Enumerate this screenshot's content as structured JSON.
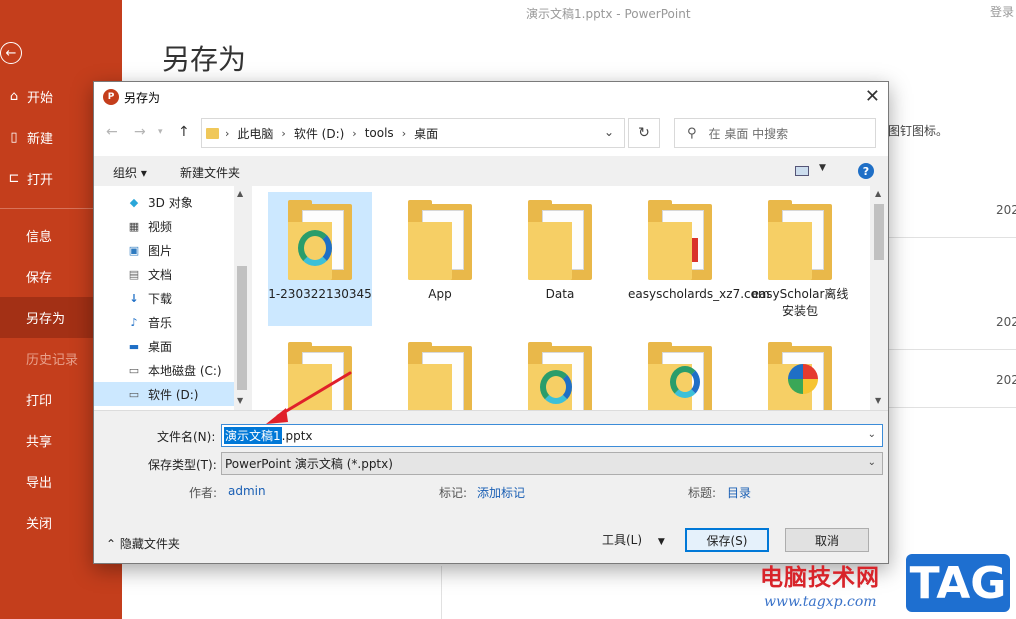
{
  "window_title": "演示文稿1.pptx  -  PowerPoint",
  "login_label": "登录",
  "backstage": {
    "heading": "另存为",
    "hint": "图钉图标。",
    "years": [
      "202",
      "202",
      "202"
    ],
    "menu": [
      {
        "label": "开始",
        "icon": "home-icon",
        "state": "normal"
      },
      {
        "label": "新建",
        "icon": "new-doc-icon",
        "state": "normal"
      },
      {
        "label": "打开",
        "icon": "open-folder-icon",
        "state": "normal"
      },
      {
        "label": "信息",
        "state": "normal"
      },
      {
        "label": "保存",
        "state": "normal"
      },
      {
        "label": "另存为",
        "state": "active"
      },
      {
        "label": "历史记录",
        "state": "disabled"
      },
      {
        "label": "打印",
        "state": "normal"
      },
      {
        "label": "共享",
        "state": "normal"
      },
      {
        "label": "导出",
        "state": "normal"
      },
      {
        "label": "关闭",
        "state": "normal"
      }
    ]
  },
  "dialog": {
    "title": "另存为",
    "address": [
      "此电脑",
      "软件 (D:)",
      "tools",
      "桌面"
    ],
    "search_placeholder": "在 桌面 中搜索",
    "toolbar": {
      "organize": "组织 ▾",
      "new_folder": "新建文件夹"
    },
    "nav_items": [
      {
        "label": "3D 对象",
        "icon": "3d-objects-icon"
      },
      {
        "label": "视频",
        "icon": "video-icon"
      },
      {
        "label": "图片",
        "icon": "pictures-icon"
      },
      {
        "label": "文档",
        "icon": "documents-icon"
      },
      {
        "label": "下载",
        "icon": "download-icon"
      },
      {
        "label": "音乐",
        "icon": "music-icon"
      },
      {
        "label": "桌面",
        "icon": "desktop-icon"
      },
      {
        "label": "本地磁盘 (C:)",
        "icon": "local-disk-icon"
      },
      {
        "label": "软件 (D:)",
        "icon": "drive-icon",
        "selected": true
      }
    ],
    "files": [
      {
        "label": "1-230322130345",
        "selected": true
      },
      {
        "label": "App"
      },
      {
        "label": "Data"
      },
      {
        "label": "easyscholards_xz7.com"
      },
      {
        "label": "easyScholar离线安装包"
      },
      {
        "label": ""
      },
      {
        "label": ""
      },
      {
        "label": ""
      },
      {
        "label": ""
      },
      {
        "label": ""
      }
    ],
    "filename_label": "文件名(N):",
    "filename_selected": "演示文稿1",
    "filename_rest": ".pptx",
    "filetype_label": "保存类型(T):",
    "filetype_value": "PowerPoint 演示文稿 (*.pptx)",
    "author_label": "作者:",
    "author_value": "admin",
    "tags_label": "标记:",
    "tags_value": "添加标记",
    "title_label": "标题:",
    "title_value": "目录",
    "hide_folders": "隐藏文件夹",
    "tools_label": "工具(L)",
    "save_label": "保存(S)",
    "cancel_label": "取消"
  },
  "watermark": {
    "text": "电脑技术网",
    "url": "www.tagxp.com",
    "logo": "TAG"
  },
  "colors": {
    "backstage_red": "#c43e1c",
    "selection_blue": "#cce8ff",
    "accent_blue": "#0078d7"
  }
}
